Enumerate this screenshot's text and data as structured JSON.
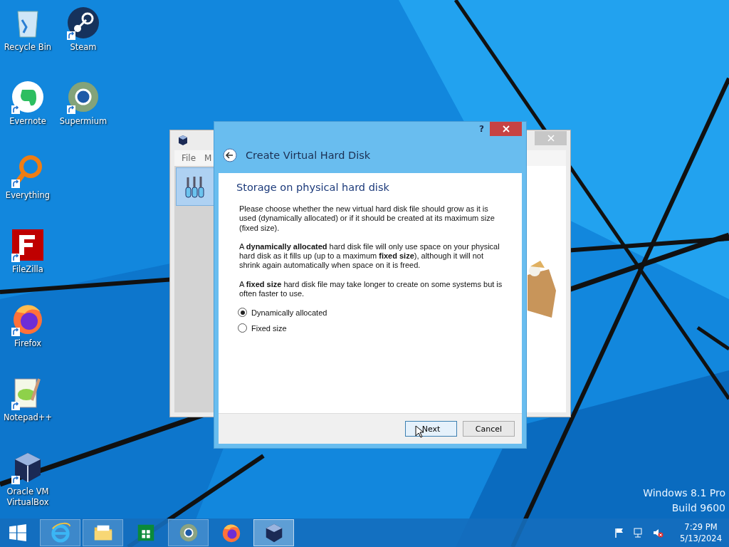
{
  "desktop_icons": [
    {
      "label": "Recycle Bin",
      "shortcut": false
    },
    {
      "label": "Evernote",
      "shortcut": true
    },
    {
      "label": "Everything",
      "shortcut": true
    },
    {
      "label": "FileZilla",
      "shortcut": true
    },
    {
      "label": "Firefox",
      "shortcut": true
    },
    {
      "label": "Notepad++",
      "shortcut": true
    },
    {
      "label": "Oracle VM VirtualBox",
      "shortcut": true
    },
    {
      "label": "Steam",
      "shortcut": true
    },
    {
      "label": "Supermium",
      "shortcut": true
    }
  ],
  "background_window": {
    "menu": [
      "File",
      "M"
    ]
  },
  "dialog": {
    "help": "?",
    "title": "Create Virtual Hard Disk",
    "heading": "Storage on physical hard disk",
    "paragraphs": [
      "Please choose whether the new virtual hard disk file should grow as it is used (dynamically allocated) or if it should be created at its maximum size (fixed size).",
      "A **dynamically allocated** hard disk file will only use space on your physical hard disk as it fills up (up to a maximum **fixed size**), although it will not shrink again automatically when space on it is freed.",
      "A **fixed size** hard disk file may take longer to create on some systems but is often faster to use."
    ],
    "options": [
      {
        "label": "Dynamically allocated",
        "selected": true
      },
      {
        "label": "Fixed size",
        "selected": false
      }
    ],
    "buttons": [
      {
        "label": "Next",
        "default": true
      },
      {
        "label": "Cancel",
        "default": false
      }
    ]
  },
  "watermark": [
    "Windows 8.1 Pro",
    "Build 9600"
  ],
  "taskbar": {
    "apps": [
      {
        "running": true,
        "active": false
      },
      {
        "running": true,
        "active": false
      },
      {
        "running": false,
        "active": false
      },
      {
        "running": true,
        "active": false
      },
      {
        "running": false,
        "active": false
      },
      {
        "running": true,
        "active": true
      }
    ],
    "time": "7:29 PM",
    "date": "5/13/2024"
  }
}
